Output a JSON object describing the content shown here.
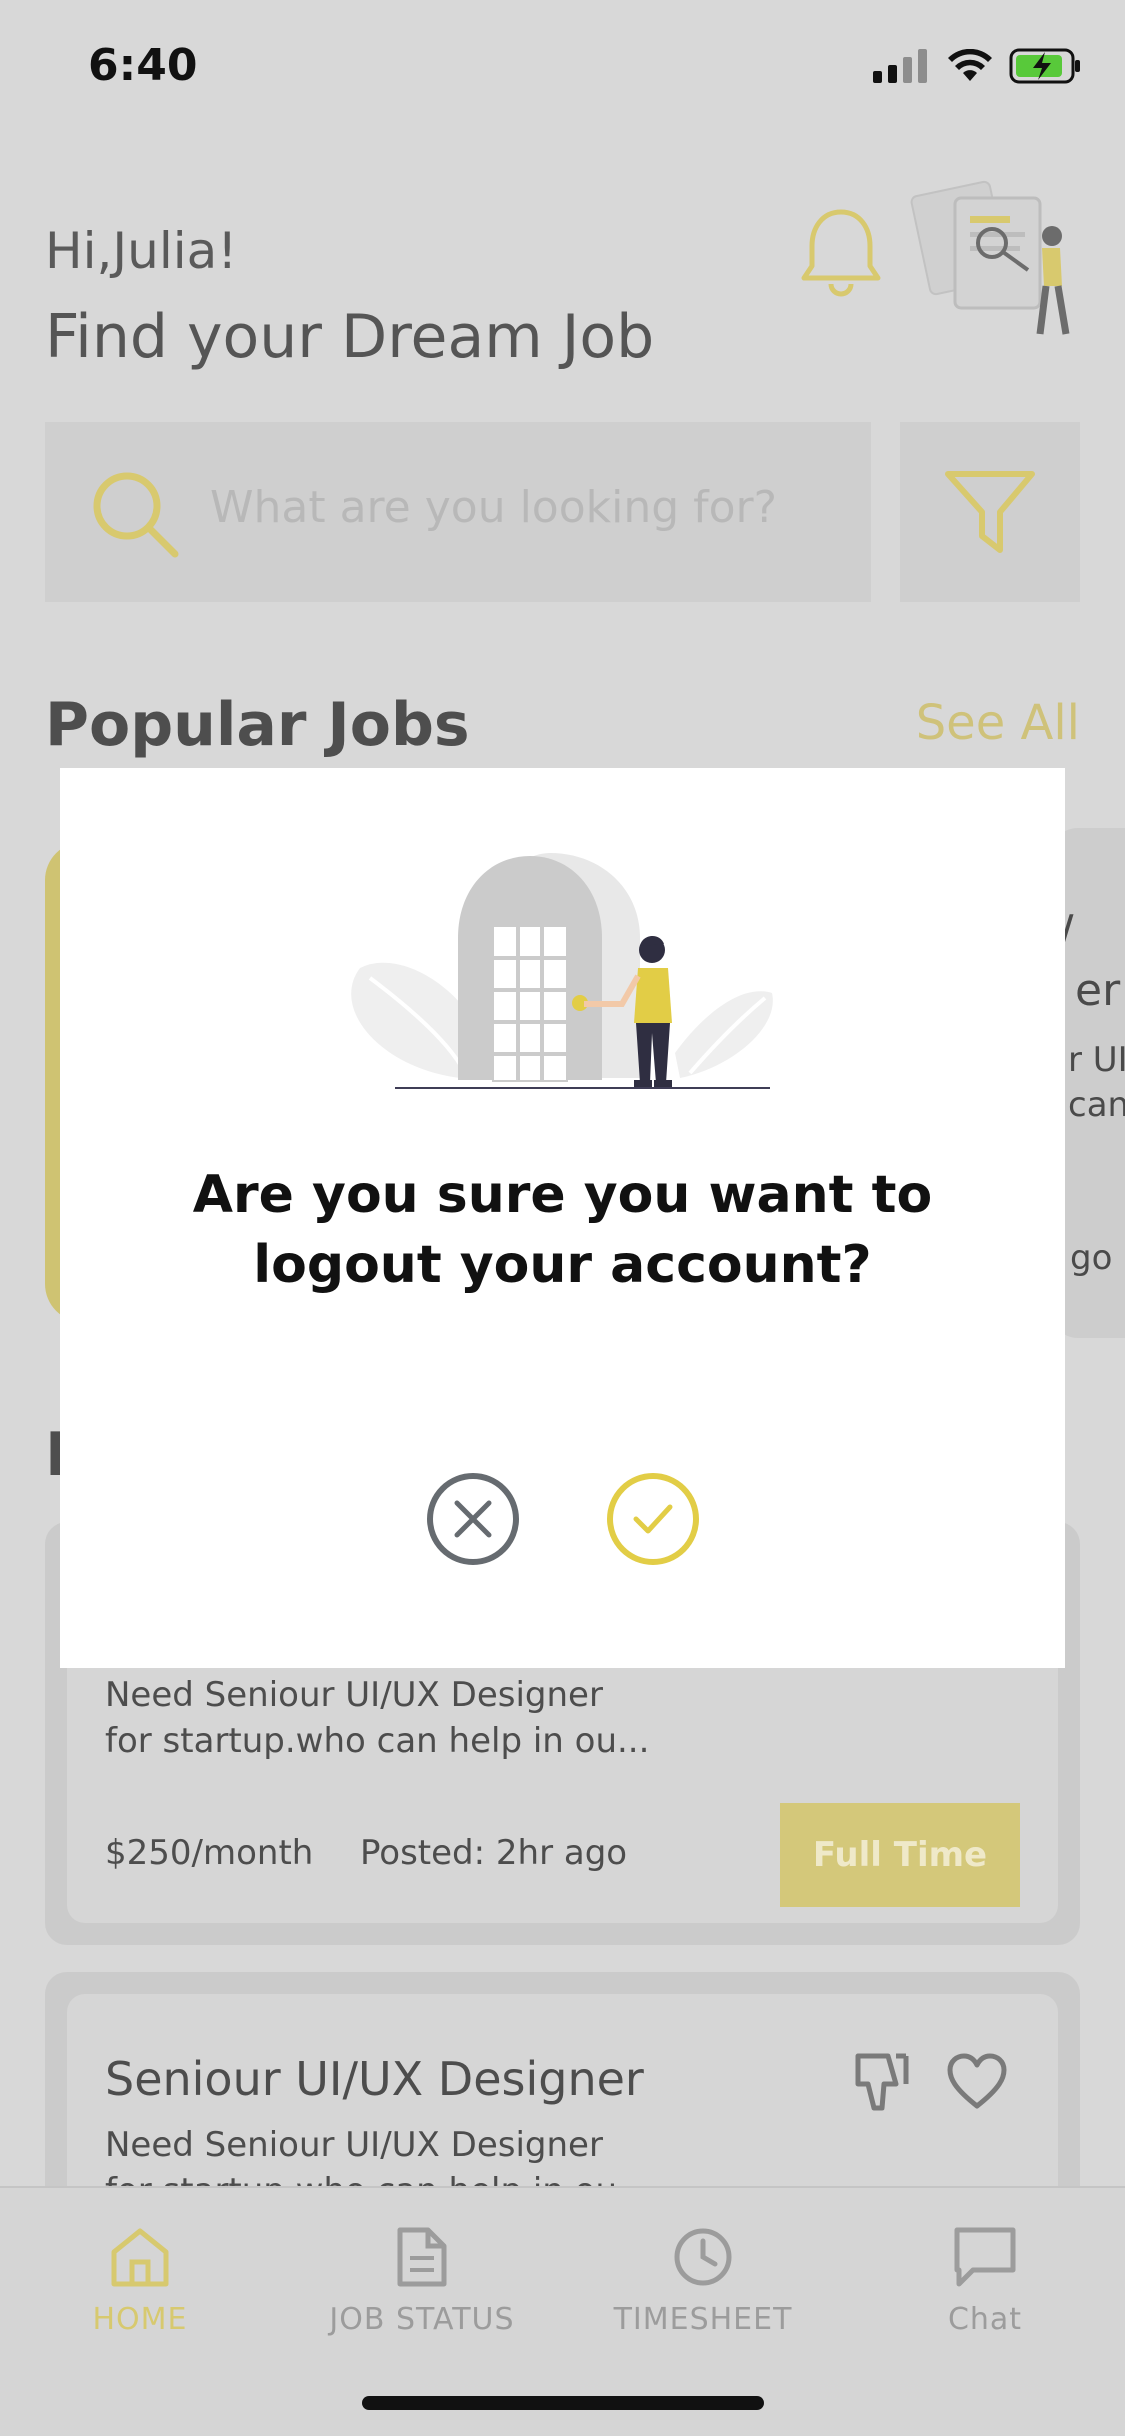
{
  "status_bar": {
    "time": "6:40"
  },
  "header": {
    "greeting": "Hi,Julia!",
    "title": "Find your Dream Job"
  },
  "search": {
    "placeholder": "What are you looking for?"
  },
  "popular": {
    "title": "Popular Jobs",
    "see_all": "See All",
    "right_card_lines": [
      "/",
      "er",
      "r UI/",
      "can",
      "go"
    ]
  },
  "recent": {
    "title_fragment": "R"
  },
  "jobs": [
    {
      "description_line1": "Need Seniour UI/UX Designer",
      "description_line2": "for startup.who can help in ou...",
      "salary": "$250/month",
      "posted": "Posted: 2hr ago",
      "type": "Full Time"
    },
    {
      "title": "Seniour UI/UX Designer",
      "description_line1": "Need Seniour UI/UX Designer",
      "description_line2": "for startup.who can help in ou..."
    }
  ],
  "nav": [
    {
      "label": "HOME",
      "icon": "home-icon",
      "active": true
    },
    {
      "label": "JOB STATUS",
      "icon": "document-icon",
      "active": false
    },
    {
      "label": "TIMESHEET",
      "icon": "clock-icon",
      "active": false
    },
    {
      "label": "Chat",
      "icon": "chat-icon",
      "active": false
    }
  ],
  "modal": {
    "question": "Are you sure you want to logout your account?",
    "cancel_icon": "close-icon",
    "confirm_icon": "check-icon"
  },
  "colors": {
    "accent": "#e2cd46",
    "muted_accent": "#d7c96f",
    "cancel": "#666b70"
  }
}
